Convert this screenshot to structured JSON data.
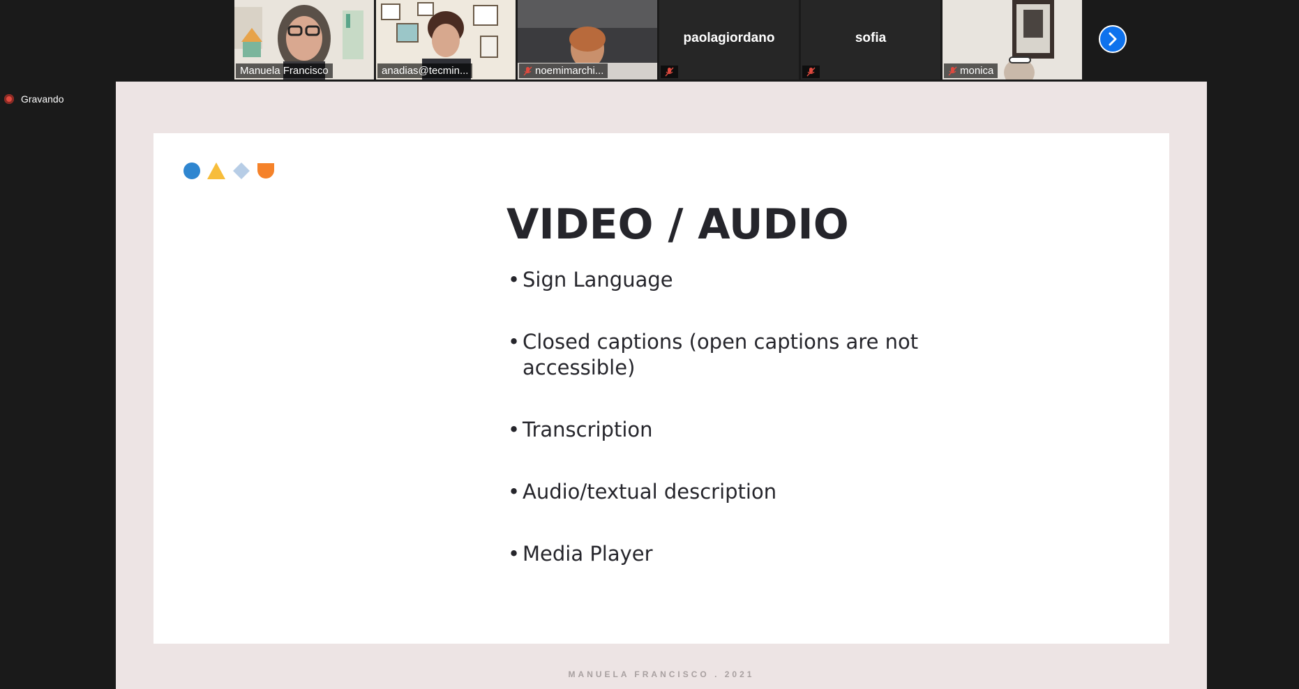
{
  "participants": [
    {
      "name": "Manuela Francisco",
      "muted": false,
      "video": true
    },
    {
      "name": "anadias@tecmin...",
      "muted": false,
      "video": true
    },
    {
      "name": "noemimarchi...",
      "muted": true,
      "video": true
    },
    {
      "name": "paolagiordano",
      "muted": true,
      "video": false
    },
    {
      "name": "sofia",
      "muted": true,
      "video": false
    },
    {
      "name": "monica",
      "muted": true,
      "video": true
    }
  ],
  "recording": {
    "label": "Gravando"
  },
  "slide": {
    "title": "VIDEO / AUDIO",
    "bullets": [
      "Sign Language",
      "Closed captions (open captions are not accessible)",
      "Transcription",
      "Audio/textual description",
      "Media Player"
    ],
    "footer": "MANUELA FRANCISCO . 2021",
    "logo_shapes": [
      {
        "shape": "circle",
        "color": "#2f86d0"
      },
      {
        "shape": "triangle",
        "color": "#f7bd3b"
      },
      {
        "shape": "diamond",
        "color": "#b7cde6"
      },
      {
        "shape": "shield",
        "color": "#f5822a"
      }
    ]
  },
  "colors": {
    "active_speaker": "#8fd14f",
    "next_button": "#0e72ed",
    "mute_red": "#e04a3f"
  }
}
